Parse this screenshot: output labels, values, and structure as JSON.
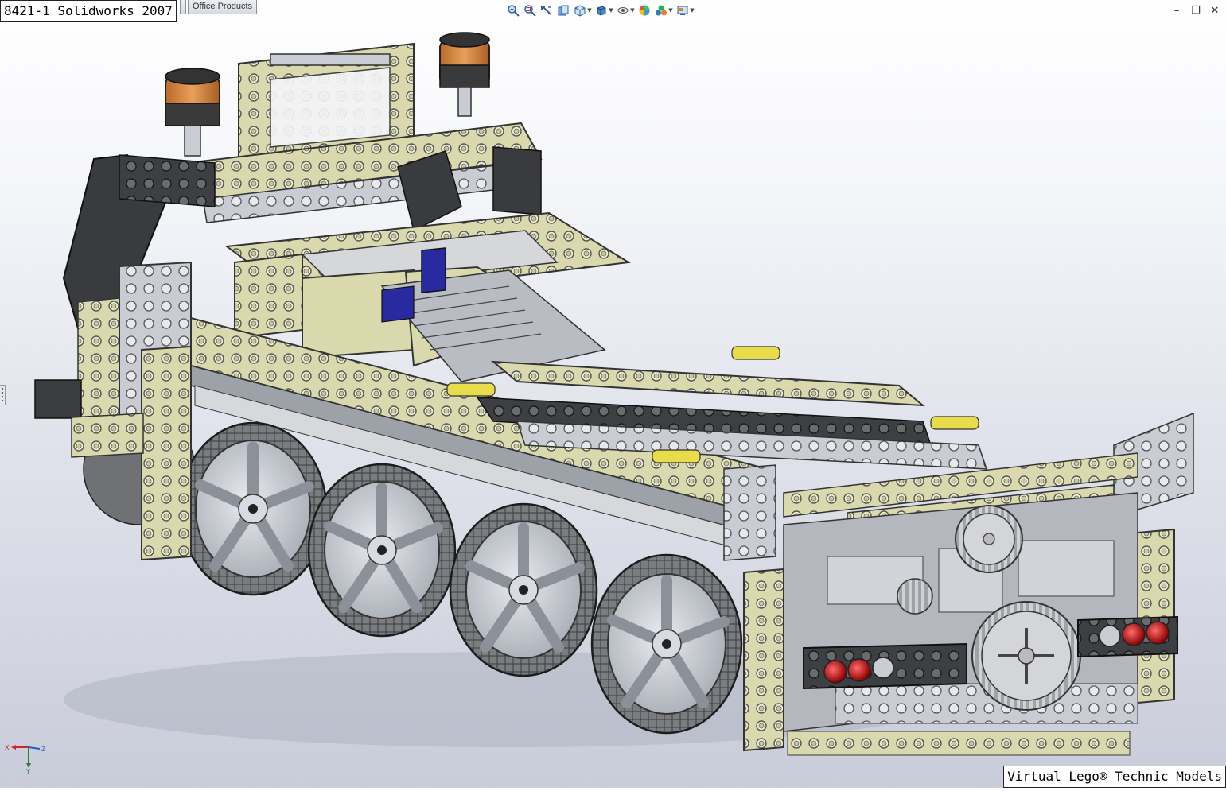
{
  "title": "8421-1 Solidworks 2007",
  "tabs": [
    "Office Products"
  ],
  "toolbar": {
    "items": [
      {
        "icon": "zoom-to-fit-icon",
        "dropdown": false
      },
      {
        "icon": "zoom-to-area-icon",
        "dropdown": false
      },
      {
        "icon": "previous-view-icon",
        "dropdown": false
      },
      {
        "icon": "section-view-icon",
        "dropdown": false
      },
      {
        "icon": "view-orientation-icon",
        "dropdown": true
      },
      {
        "icon": "display-style-icon",
        "dropdown": true
      },
      {
        "icon": "hide-show-items-icon",
        "dropdown": true
      },
      {
        "icon": "edit-appearance-icon",
        "dropdown": false
      },
      {
        "icon": "apply-scene-icon",
        "dropdown": true
      },
      {
        "icon": "view-settings-icon",
        "dropdown": true
      }
    ]
  },
  "window_controls": {
    "minimize": "–",
    "restore": "❐",
    "close": "✕"
  },
  "viewport": {
    "model": "lego-technic-truck-chassis-8421",
    "colors": {
      "beam": "#dcdcb0",
      "gray": "#c8cbd0",
      "dark": "#4a4a4a",
      "tire": "#7d7f83",
      "rim": "#c9ced5",
      "orange": "#d9883c",
      "red": "#b01010",
      "blue": "#2a2aa0",
      "yellow": "#e8dc4a"
    }
  },
  "triad": {
    "x": "X",
    "y": "Y",
    "z": "Z"
  },
  "watermark": "Virtual Lego® Technic Models"
}
